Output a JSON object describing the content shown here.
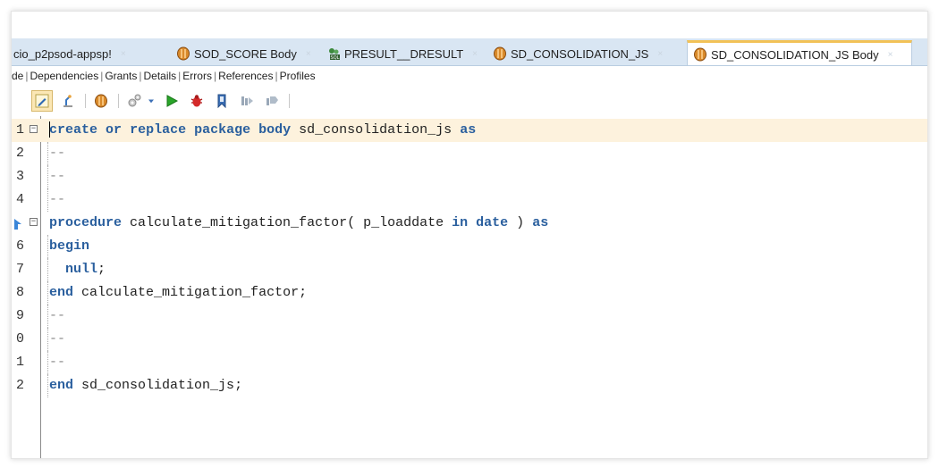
{
  "tabs": [
    {
      "label": "cio_p2psod-appsp!",
      "icon": null,
      "active": false
    },
    {
      "label": "SOD_SCORE Body",
      "icon": "package-icon",
      "active": false
    },
    {
      "label": "PRESULT__DRESULT",
      "icon": "sql-user-icon",
      "active": false
    },
    {
      "label": "SD_CONSOLIDATION_JS",
      "icon": "package-icon",
      "active": false
    },
    {
      "label": "SD_CONSOLIDATION_JS Body",
      "icon": "package-icon",
      "active": true
    }
  ],
  "close_glyph": "×",
  "subtabs": [
    "de",
    "Dependencies",
    "Grants",
    "Details",
    "Errors",
    "References",
    "Profiles"
  ],
  "subtab_separator": "|",
  "toolbar_icons": [
    "edit-icon",
    "compile-icon",
    "package-icon",
    "settings-icon",
    "dropdown-arrow-icon",
    "run-icon",
    "debug-icon",
    "bookmark-icon",
    "profile-icon",
    "profile2-icon"
  ],
  "editor": {
    "lines": [
      {
        "num": "1",
        "text": "create or replace package body sd_consolidation_js as",
        "fold": true,
        "current": true
      },
      {
        "num": "2",
        "text": "--"
      },
      {
        "num": "3",
        "text": "--"
      },
      {
        "num": "4",
        "text": "--"
      },
      {
        "num": "",
        "text": "procedure calculate_mitigation_factor( p_loaddate in date ) as",
        "fold": true,
        "marker": true
      },
      {
        "num": "6",
        "text": "begin"
      },
      {
        "num": "7",
        "text": "  null;"
      },
      {
        "num": "8",
        "text": "end calculate_mitigation_factor;"
      },
      {
        "num": "9",
        "text": "--"
      },
      {
        "num": "0",
        "text": "--"
      },
      {
        "num": "1",
        "text": "--"
      },
      {
        "num": "2",
        "text": "end sd_consolidation_js;"
      }
    ]
  },
  "colors": {
    "keyword": "#2a5f9e",
    "comment": "#8a8a8a",
    "current_line": "#fdf2dd",
    "tab_bar": "#d9e6f3",
    "active_tab_accent": "#f2c257"
  }
}
